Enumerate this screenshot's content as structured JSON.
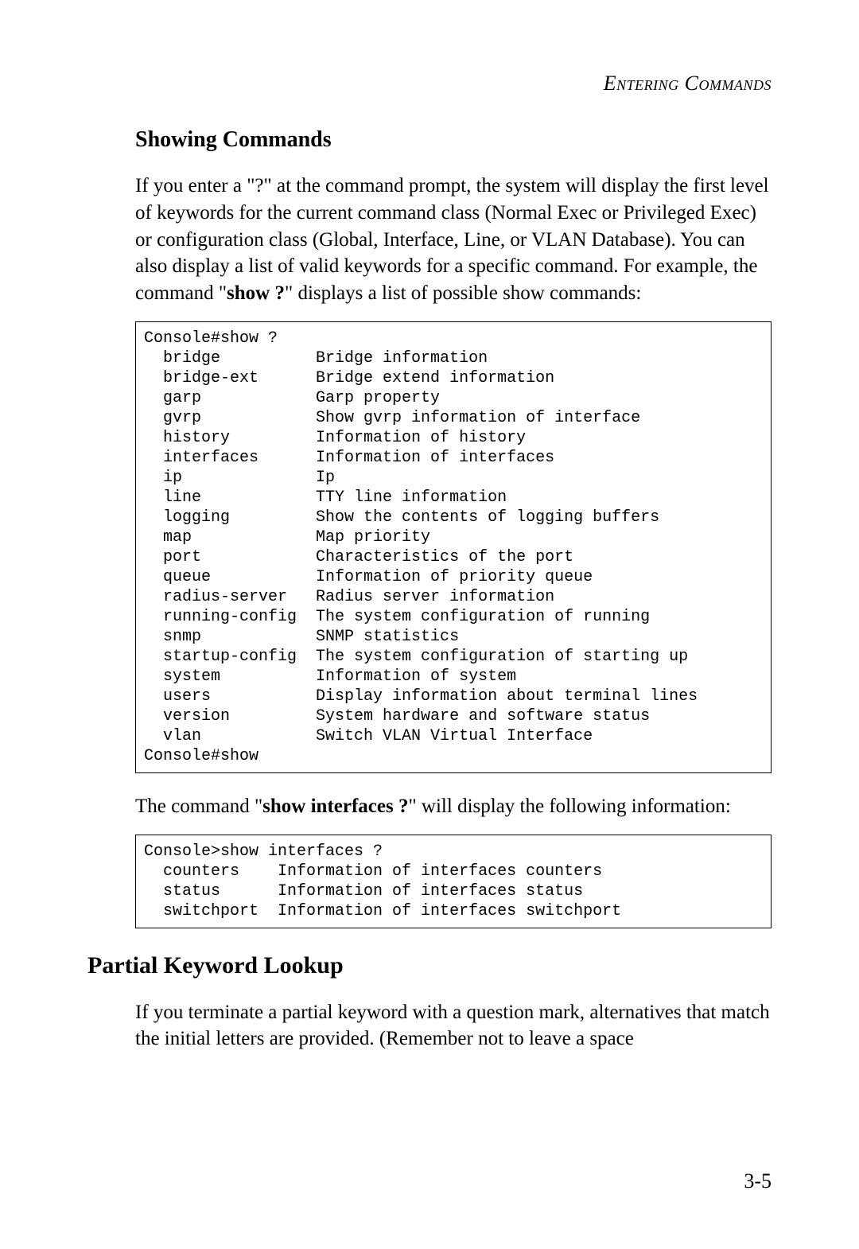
{
  "header": {
    "running_head": "Entering Commands"
  },
  "section1": {
    "heading": "Showing Commands",
    "para_before": "If you enter a \"?\" at the command prompt, the system will display the first level of keywords for the current command class (Normal Exec or Privileged Exec) or configuration class (Global, Interface, Line, or VLAN Database). You can also display a list of valid keywords for a specific command. For example, the command \"",
    "para_cmd": "show ?",
    "para_after": "\" displays a list of possible show commands:",
    "code1": "Console#show ?\n  bridge          Bridge information\n  bridge-ext      Bridge extend information\n  garp            Garp property\n  gvrp            Show gvrp information of interface\n  history         Information of history\n  interfaces      Information of interfaces\n  ip              Ip\n  line            TTY line information\n  logging         Show the contents of logging buffers\n  map             Map priority\n  port            Characteristics of the port\n  queue           Information of priority queue\n  radius-server   Radius server information\n  running-config  The system configuration of running\n  snmp            SNMP statistics\n  startup-config  The system configuration of starting up\n  system          Information of system\n  users           Display information about terminal lines\n  version         System hardware and software status\n  vlan            Switch VLAN Virtual Interface\nConsole#show",
    "para2_before": "The command \"",
    "para2_cmd": "show interfaces ?",
    "para2_after": "\" will display the following information:",
    "code2": "Console>show interfaces ?\n  counters    Information of interfaces counters\n  status      Information of interfaces status\n  switchport  Information of interfaces switchport"
  },
  "section2": {
    "heading": "Partial Keyword Lookup",
    "para": "If you terminate a partial keyword with a question mark, alternatives that match the initial letters are provided. (Remember not to leave a space"
  },
  "footer": {
    "page_num": "3-5"
  }
}
